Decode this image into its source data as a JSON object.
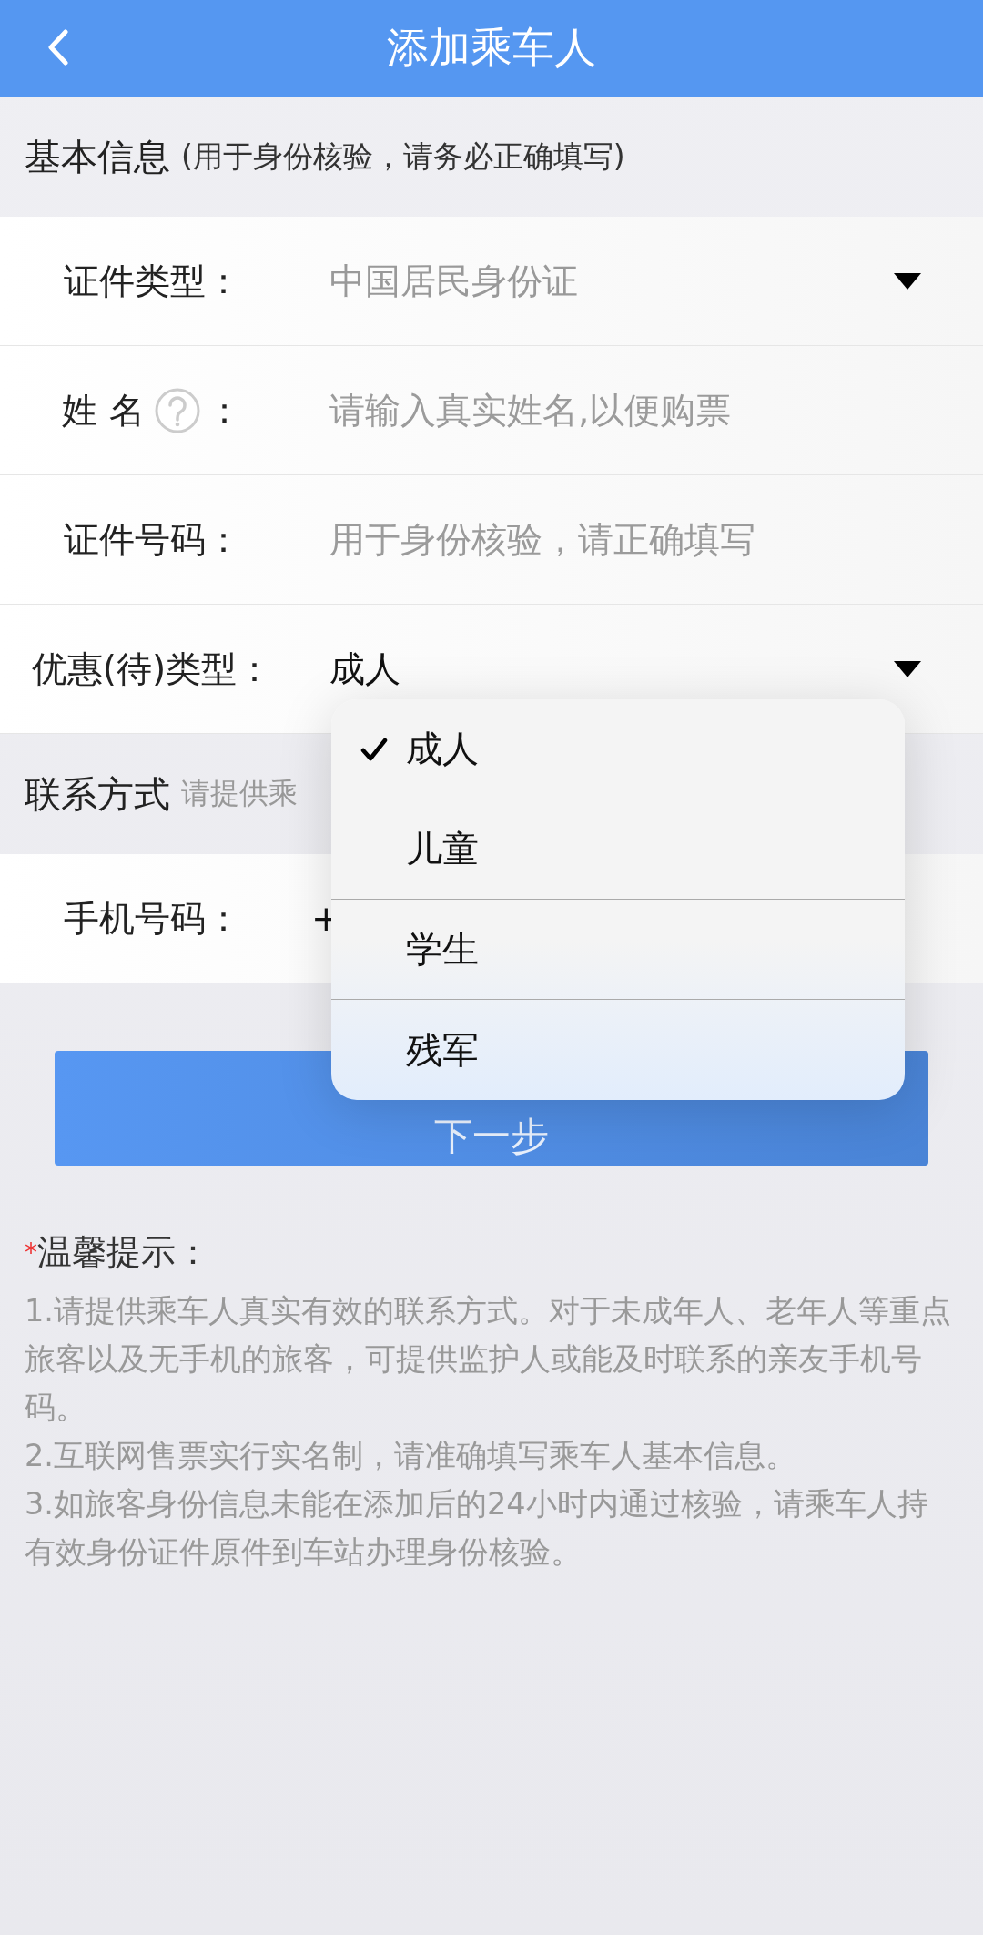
{
  "nav": {
    "title": "添加乘车人"
  },
  "sections": [
    {
      "title": "基本信息",
      "note": "(用于身份核验，请务必正确填写)",
      "fields": [
        {
          "kind": "select",
          "label": "证件类型：",
          "value": "中国居民身份证",
          "disabled": true
        },
        {
          "kind": "input",
          "label": "姓 名",
          "help": true,
          "label_end": "：",
          "placeholder": "请输入真实姓名,以便购票"
        },
        {
          "kind": "input",
          "label": "证件号码：",
          "placeholder": "用于身份核验，请正确填写"
        },
        {
          "kind": "select",
          "label": "优惠(待)类型：",
          "value": "成人",
          "disabled": false
        }
      ]
    },
    {
      "title": "联系方式",
      "note": "请提供乘",
      "fields": [
        {
          "kind": "input",
          "label": "手机号码：",
          "value": "+"
        }
      ]
    }
  ],
  "next_button": "下一步",
  "dropdown": {
    "options": [
      {
        "label": "成人",
        "selected": true
      },
      {
        "label": "儿童",
        "selected": false
      },
      {
        "label": "学生",
        "selected": false
      },
      {
        "label": "残军",
        "selected": false
      }
    ]
  },
  "tips": {
    "mark": "*",
    "title": "温馨提示：",
    "items": [
      "1.请提供乘车人真实有效的联系方式。对于未成年人、老年人等重点旅客以及无手机的旅客，可提供监护人或能及时联系的亲友手机号码。",
      "2.互联网售票实行实名制，请准确填写乘车人基本信息。",
      "3.如旅客身份信息未能在添加后的24小时内通过核验，请乘车人持有效身份证件原件到车站办理身份核验。"
    ]
  }
}
